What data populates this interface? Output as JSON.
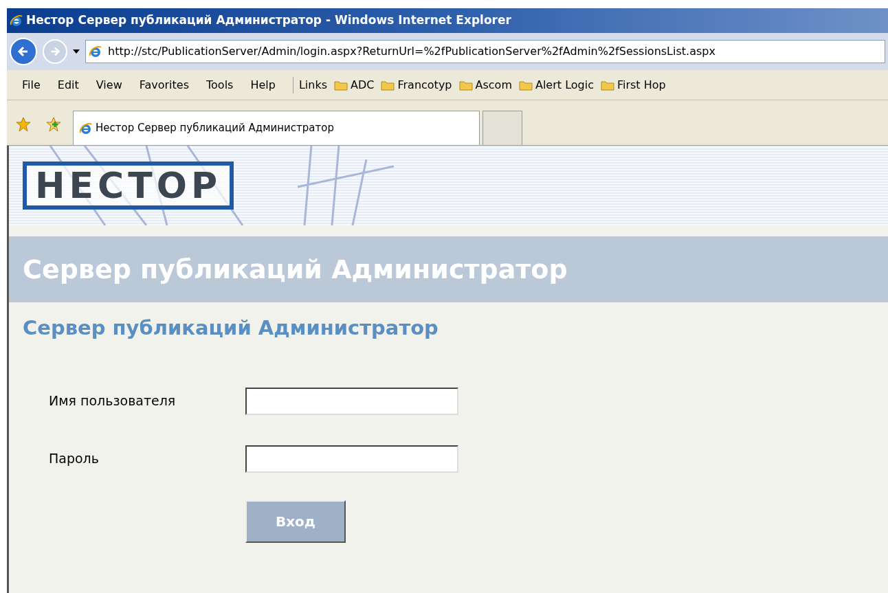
{
  "window": {
    "title": "Нестор Сервер публикаций Администратор - Windows Internet Explorer"
  },
  "address_bar": {
    "url": "http://stc/PublicationServer/Admin/login.aspx?ReturnUrl=%2fPublicationServer%2fAdmin%2fSessionsList.aspx"
  },
  "menu": [
    "File",
    "Edit",
    "View",
    "Favorites",
    "Tools",
    "Help"
  ],
  "links": {
    "label": "Links",
    "items": [
      "ADC",
      "Francotyp",
      "Ascom",
      "Alert Logic",
      "First Hop"
    ]
  },
  "tabs": [
    {
      "label": "Нестор Сервер публикаций Администратор",
      "selected": true
    }
  ],
  "page": {
    "logo": "НЕСТОР",
    "banner": "Сервер публикаций Администратор",
    "heading": "Сервер публикаций Администратор",
    "fields": [
      {
        "label": "Имя пользователя"
      },
      {
        "label": "Пароль"
      }
    ],
    "button": {
      "label": "Вход",
      "disabled": true
    }
  }
}
